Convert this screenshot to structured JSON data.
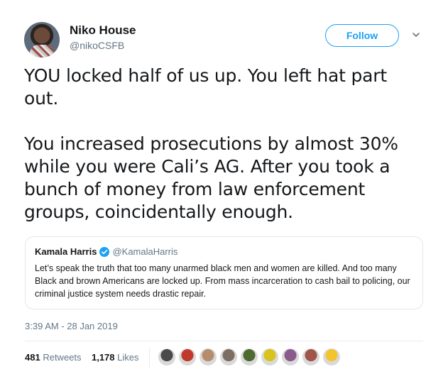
{
  "tweet": {
    "author_name": "Niko House",
    "author_handle": "@nikoCSFB",
    "follow_label": "Follow",
    "text": "YOU locked half of us up. You left hat part\nout.\n\nYou increased prosecutions by almost 30%\nwhile you were Cali’s AG. After you took a\nbunch of money from law enforcement\ngroups, coincidentally enough.",
    "timestamp": "3:39 AM - 28 Jan 2019"
  },
  "quoted_tweet": {
    "author_name": "Kamala Harris",
    "author_handle": "@KamalaHarris",
    "verified": true,
    "text": "Let’s speak the truth that too many unarmed black men and women are killed. And too many Black and brown Americans are locked up. From mass incarceration to cash bail to policing, our criminal justice system needs drastic repair."
  },
  "stats": {
    "retweets_count": "481",
    "retweets_label": "Retweets",
    "likes_count": "1,178",
    "likes_label": "Likes"
  },
  "likers": [
    {
      "color": "#4a4a4a"
    },
    {
      "color": "#c0392b"
    },
    {
      "color": "#b58d6e"
    },
    {
      "color": "#7d6e63"
    },
    {
      "color": "#4d6b2f"
    },
    {
      "color": "#d8c31e"
    },
    {
      "color": "#8a5a8c"
    },
    {
      "color": "#a0544a"
    },
    {
      "color": "#f4c430"
    }
  ],
  "colors": {
    "accent": "#1da1f2",
    "secondary_text": "#657786",
    "border": "#e1e8ed"
  }
}
